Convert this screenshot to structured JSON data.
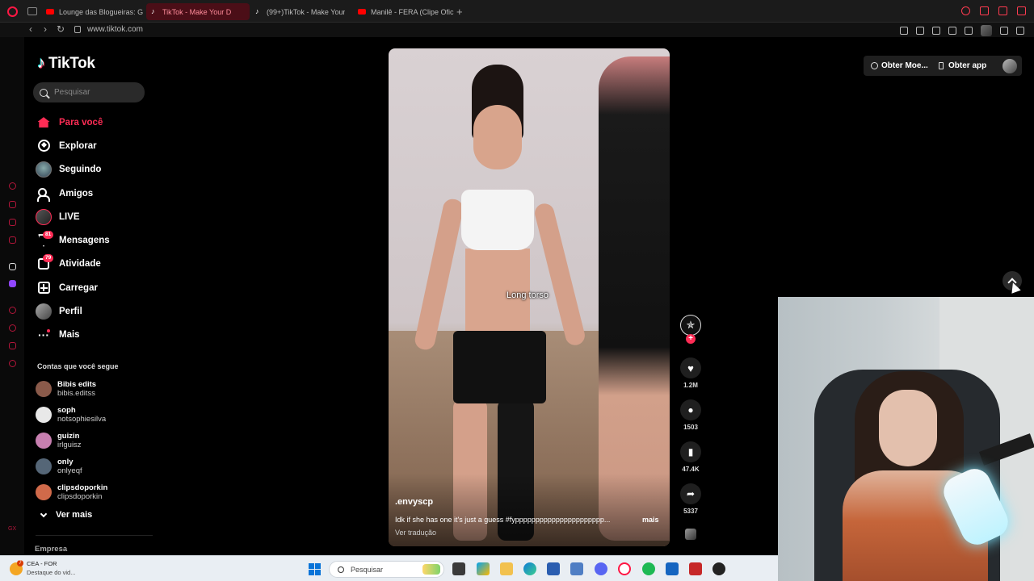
{
  "browser": {
    "tabs": [
      {
        "label": "Lounge das Blogueiras: G",
        "type": "youtube",
        "active": false
      },
      {
        "label": "TikTok - Make Your D",
        "type": "tiktok",
        "active": true
      },
      {
        "label": "(99+)TikTok - Make Your",
        "type": "tiktok",
        "active": false
      },
      {
        "label": "Manilê - FERA (Clipe Ofic",
        "type": "youtube",
        "active": false
      }
    ],
    "url": "www.tiktok.com"
  },
  "tiktok": {
    "logo_text": "TikTok",
    "search_placeholder": "Pesquisar",
    "nav": [
      {
        "id": "for-you",
        "label": "Para você",
        "icon": "home-icon",
        "active": true
      },
      {
        "id": "explore",
        "label": "Explorar",
        "icon": "compass-icon"
      },
      {
        "id": "following",
        "label": "Seguindo",
        "icon": "following-avatar-icon"
      },
      {
        "id": "friends",
        "label": "Amigos",
        "icon": "friends-icon"
      },
      {
        "id": "live",
        "label": "LIVE",
        "icon": "live-icon"
      },
      {
        "id": "messages",
        "label": "Mensagens",
        "icon": "send-icon",
        "badge": "81"
      },
      {
        "id": "activity",
        "label": "Atividade",
        "icon": "inbox-icon",
        "badge": "79"
      },
      {
        "id": "upload",
        "label": "Carregar",
        "icon": "plus-square-icon"
      },
      {
        "id": "profile",
        "label": "Perfil",
        "icon": "profile-avatar-icon"
      },
      {
        "id": "more",
        "label": "Mais",
        "icon": "more-dots-icon"
      }
    ],
    "following_title": "Contas que você segue",
    "following": [
      {
        "name": "Bibis edits",
        "username": "bibis.editss",
        "color": "#8a5a4a"
      },
      {
        "name": "soph",
        "username": "notsophiesilva",
        "color": "#e8e8e8"
      },
      {
        "name": "guizin",
        "username": "irlguisz",
        "color": "#c77fb0"
      },
      {
        "name": "only",
        "username": "onlyeqf",
        "color": "#556677"
      },
      {
        "name": "clipsdoporkin",
        "username": "clipsdoporkin",
        "color": "#d06a4a"
      }
    ],
    "see_more": "Ver mais",
    "footer_link": "Empresa",
    "top_bar": {
      "coins_label": "Obter Moe...",
      "app_label": "Obter app"
    },
    "video": {
      "overlay_caption": "Long torso",
      "author": ".envyscp",
      "description": "Idk if she has one it's just a guess #fypppppppppppppppppppppp...",
      "more_label": "mais",
      "translate_label": "Ver tradução"
    },
    "actions": {
      "likes": "1.2M",
      "comments": "1503",
      "saves": "47.4K",
      "shares": "5337"
    }
  },
  "taskbar": {
    "weather_title": "CEA - FOR",
    "weather_subtitle": "Destaque do vid...",
    "weather_badge": "7",
    "search_placeholder": "Pesquisar"
  },
  "colors": {
    "accent": "#fe2c55",
    "browser_accent": "#ff1744",
    "background": "#000000"
  }
}
